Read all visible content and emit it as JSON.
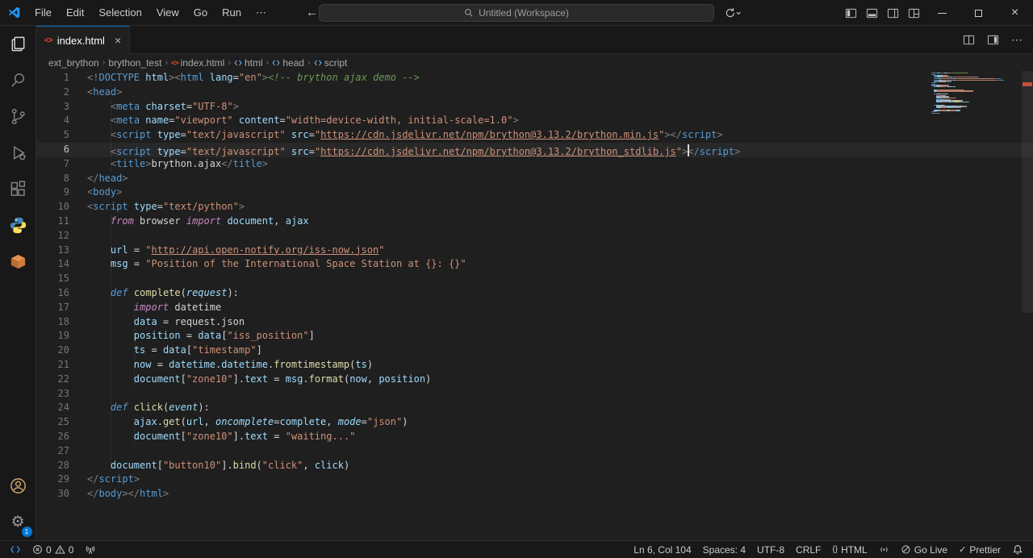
{
  "title_bar": {
    "menus": [
      "File",
      "Edit",
      "Selection",
      "View",
      "Go",
      "Run",
      "⋯"
    ],
    "search_text": "Untitled (Workspace)"
  },
  "activity_bar": {
    "items": [
      "explorer",
      "search",
      "source-control",
      "run-and-debug",
      "extensions",
      "python",
      "container"
    ],
    "footer": [
      "account",
      "manage"
    ],
    "manage_badge": "1"
  },
  "tab": {
    "label": "index.html"
  },
  "breadcrumbs": [
    {
      "label": "ext_brython"
    },
    {
      "label": "brython_test"
    },
    {
      "label": "index.html"
    },
    {
      "label": "html"
    },
    {
      "label": "head"
    },
    {
      "label": "script"
    }
  ],
  "editor": {
    "active_line": 6,
    "lines": [
      [
        [
          "br",
          "<!"
        ],
        [
          "tag",
          "DOCTYPE"
        ],
        [
          "attr",
          " html"
        ],
        [
          "br",
          ">"
        ],
        [
          "br",
          "<"
        ],
        [
          "tag",
          "html"
        ],
        [
          "attr",
          " lang"
        ],
        [
          "txt",
          "="
        ],
        [
          "str",
          "\"en\""
        ],
        [
          "br",
          ">"
        ],
        [
          "com",
          "<!-- brython ajax demo -->"
        ]
      ],
      [
        [
          "br",
          "<"
        ],
        [
          "tag",
          "head"
        ],
        [
          "br",
          ">"
        ]
      ],
      [
        [
          "txt",
          "    "
        ],
        [
          "br",
          "<"
        ],
        [
          "tag",
          "meta"
        ],
        [
          "attr",
          " charset"
        ],
        [
          "txt",
          "="
        ],
        [
          "str",
          "\"UTF-8\""
        ],
        [
          "br",
          ">"
        ]
      ],
      [
        [
          "txt",
          "    "
        ],
        [
          "br",
          "<"
        ],
        [
          "tag",
          "meta"
        ],
        [
          "attr",
          " name"
        ],
        [
          "txt",
          "="
        ],
        [
          "str",
          "\"viewport\""
        ],
        [
          "attr",
          " content"
        ],
        [
          "txt",
          "="
        ],
        [
          "str",
          "\"width=device-width, initial-scale=1.0\""
        ],
        [
          "br",
          ">"
        ]
      ],
      [
        [
          "txt",
          "    "
        ],
        [
          "br",
          "<"
        ],
        [
          "tag",
          "script"
        ],
        [
          "attr",
          " type"
        ],
        [
          "txt",
          "="
        ],
        [
          "str",
          "\"text/javascript\""
        ],
        [
          "attr",
          " src"
        ],
        [
          "txt",
          "="
        ],
        [
          "str",
          "\""
        ],
        [
          "lnk",
          "https://cdn.jsdelivr.net/npm/brython@3.13.2/brython.min.js"
        ],
        [
          "str",
          "\""
        ],
        [
          "br",
          ">"
        ],
        [
          "br",
          "</"
        ],
        [
          "tag",
          "script"
        ],
        [
          "br",
          ">"
        ]
      ],
      [
        [
          "txt",
          "    "
        ],
        [
          "br",
          "<"
        ],
        [
          "tag",
          "script"
        ],
        [
          "attr",
          " type"
        ],
        [
          "txt",
          "="
        ],
        [
          "str",
          "\"text/javascript\""
        ],
        [
          "attr",
          " src"
        ],
        [
          "txt",
          "="
        ],
        [
          "str",
          "\""
        ],
        [
          "lnk",
          "https://cdn.jsdelivr.net/npm/brython@3.13.2/brython_stdlib.js"
        ],
        [
          "str",
          "\""
        ],
        [
          "br",
          ">"
        ],
        [
          "cur",
          ""
        ],
        [
          "br",
          "</"
        ],
        [
          "tag",
          "script"
        ],
        [
          "br",
          ">"
        ]
      ],
      [
        [
          "txt",
          "    "
        ],
        [
          "br",
          "<"
        ],
        [
          "tag",
          "title"
        ],
        [
          "br",
          ">"
        ],
        [
          "txt",
          "brython.ajax"
        ],
        [
          "br",
          "</"
        ],
        [
          "tag",
          "title"
        ],
        [
          "br",
          ">"
        ]
      ],
      [
        [
          "br",
          "</"
        ],
        [
          "tag",
          "head"
        ],
        [
          "br",
          ">"
        ]
      ],
      [
        [
          "br",
          "<"
        ],
        [
          "tag",
          "body"
        ],
        [
          "br",
          ">"
        ]
      ],
      [
        [
          "br",
          "<"
        ],
        [
          "tag",
          "script"
        ],
        [
          "attr",
          " type"
        ],
        [
          "txt",
          "="
        ],
        [
          "str",
          "\"text/python\""
        ],
        [
          "br",
          ">"
        ]
      ],
      [
        [
          "txt",
          "    "
        ],
        [
          "kw",
          "from"
        ],
        [
          "txt",
          " browser "
        ],
        [
          "kw",
          "import"
        ],
        [
          "txt",
          " "
        ],
        [
          "var",
          "document"
        ],
        [
          "txt",
          ", "
        ],
        [
          "var",
          "ajax"
        ]
      ],
      [],
      [
        [
          "txt",
          "    "
        ],
        [
          "var",
          "url"
        ],
        [
          "txt",
          " = "
        ],
        [
          "str",
          "\""
        ],
        [
          "lnk",
          "http://api.open-notify.org/iss-now.json"
        ],
        [
          "str",
          "\""
        ]
      ],
      [
        [
          "txt",
          "    "
        ],
        [
          "var",
          "msg"
        ],
        [
          "txt",
          " = "
        ],
        [
          "str",
          "\"Position of the International Space Station at {}: {}\""
        ]
      ],
      [],
      [
        [
          "txt",
          "    "
        ],
        [
          "def",
          "def"
        ],
        [
          "txt",
          " "
        ],
        [
          "fn",
          "complete"
        ],
        [
          "txt",
          "("
        ],
        [
          "par",
          "request"
        ],
        [
          "txt",
          "):"
        ]
      ],
      [
        [
          "txt",
          "        "
        ],
        [
          "kw",
          "import"
        ],
        [
          "txt",
          " datetime"
        ]
      ],
      [
        [
          "txt",
          "        "
        ],
        [
          "var",
          "data"
        ],
        [
          "txt",
          " = request.json"
        ]
      ],
      [
        [
          "txt",
          "        "
        ],
        [
          "var",
          "position"
        ],
        [
          "txt",
          " = "
        ],
        [
          "var",
          "data"
        ],
        [
          "txt",
          "["
        ],
        [
          "str",
          "\"iss_position\""
        ],
        [
          "txt",
          "]"
        ]
      ],
      [
        [
          "txt",
          "        "
        ],
        [
          "var",
          "ts"
        ],
        [
          "txt",
          " = "
        ],
        [
          "var",
          "data"
        ],
        [
          "txt",
          "["
        ],
        [
          "str",
          "\"timestamp\""
        ],
        [
          "txt",
          "]"
        ]
      ],
      [
        [
          "txt",
          "        "
        ],
        [
          "var",
          "now"
        ],
        [
          "txt",
          " = "
        ],
        [
          "var",
          "datetime"
        ],
        [
          "txt",
          "."
        ],
        [
          "var",
          "datetime"
        ],
        [
          "txt",
          "."
        ],
        [
          "fn",
          "fromtimestamp"
        ],
        [
          "txt",
          "("
        ],
        [
          "var",
          "ts"
        ],
        [
          "txt",
          ")"
        ]
      ],
      [
        [
          "txt",
          "        "
        ],
        [
          "var",
          "document"
        ],
        [
          "txt",
          "["
        ],
        [
          "str",
          "\"zone10\""
        ],
        [
          "txt",
          "]."
        ],
        [
          "var",
          "text"
        ],
        [
          "txt",
          " = "
        ],
        [
          "var",
          "msg"
        ],
        [
          "txt",
          "."
        ],
        [
          "fn",
          "format"
        ],
        [
          "txt",
          "("
        ],
        [
          "var",
          "now"
        ],
        [
          "txt",
          ", "
        ],
        [
          "var",
          "position"
        ],
        [
          "txt",
          ")"
        ]
      ],
      [],
      [
        [
          "txt",
          "    "
        ],
        [
          "def",
          "def"
        ],
        [
          "txt",
          " "
        ],
        [
          "fn",
          "click"
        ],
        [
          "txt",
          "("
        ],
        [
          "par",
          "event"
        ],
        [
          "txt",
          "):"
        ]
      ],
      [
        [
          "txt",
          "        "
        ],
        [
          "var",
          "ajax"
        ],
        [
          "txt",
          "."
        ],
        [
          "fn",
          "get"
        ],
        [
          "txt",
          "("
        ],
        [
          "var",
          "url"
        ],
        [
          "txt",
          ", "
        ],
        [
          "par",
          "oncomplete"
        ],
        [
          "txt",
          "="
        ],
        [
          "var",
          "complete"
        ],
        [
          "txt",
          ", "
        ],
        [
          "par",
          "mode"
        ],
        [
          "txt",
          "="
        ],
        [
          "str",
          "\"json\""
        ],
        [
          "txt",
          ")"
        ]
      ],
      [
        [
          "txt",
          "        "
        ],
        [
          "var",
          "document"
        ],
        [
          "txt",
          "["
        ],
        [
          "str",
          "\"zone10\""
        ],
        [
          "txt",
          "]."
        ],
        [
          "var",
          "text"
        ],
        [
          "txt",
          " = "
        ],
        [
          "str",
          "\"waiting...\""
        ]
      ],
      [],
      [
        [
          "txt",
          "    "
        ],
        [
          "var",
          "document"
        ],
        [
          "txt",
          "["
        ],
        [
          "str",
          "\"button10\""
        ],
        [
          "txt",
          "]."
        ],
        [
          "fn",
          "bind"
        ],
        [
          "txt",
          "("
        ],
        [
          "str",
          "\"click\""
        ],
        [
          "txt",
          ", "
        ],
        [
          "var",
          "click"
        ],
        [
          "txt",
          ")"
        ]
      ],
      [
        [
          "br",
          "</"
        ],
        [
          "tag",
          "script"
        ],
        [
          "br",
          ">"
        ]
      ],
      [
        [
          "br",
          "</"
        ],
        [
          "tag",
          "body"
        ],
        [
          "br",
          "></"
        ],
        [
          "tag",
          "html"
        ],
        [
          "br",
          ">"
        ]
      ]
    ]
  },
  "status_bar": {
    "errors": "0",
    "warnings": "0",
    "ln_col": "Ln 6, Col 104",
    "spaces": "Spaces: 4",
    "encoding": "UTF-8",
    "eol": "CRLF",
    "language": "HTML",
    "go_live": "Go Live",
    "prettier": "Prettier"
  }
}
